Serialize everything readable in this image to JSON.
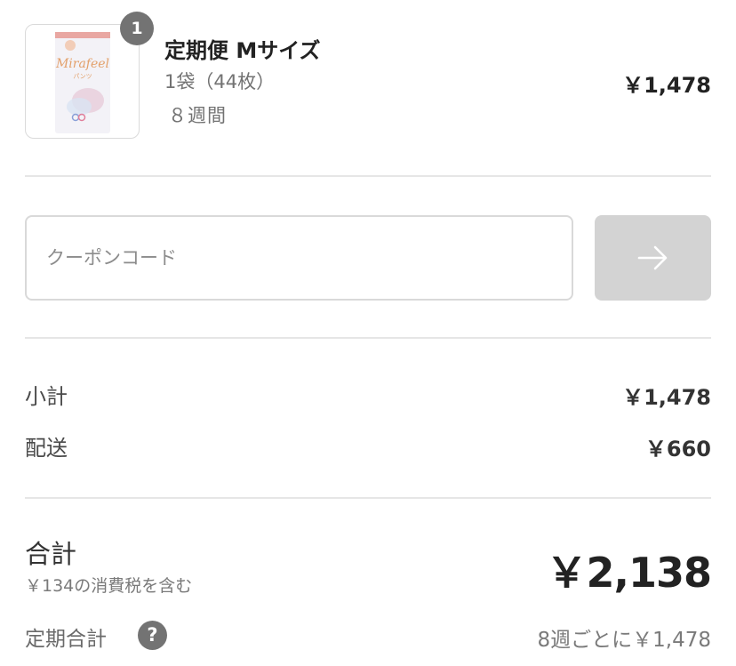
{
  "item": {
    "quantity": "1",
    "title": "定期便 Mサイズ",
    "variant": "1袋（44枚）",
    "interval": "８週間",
    "price": "￥1,478",
    "image": {
      "brand_text": "Mirafeel",
      "sub_text": "パンツ",
      "colors": {
        "pack": "#f3f2f7",
        "band": "#e9a7a2",
        "brand": "#e3a06a",
        "accent": "#e5c8d6"
      }
    }
  },
  "coupon": {
    "placeholder": "クーポンコード",
    "value": "",
    "submit_icon": "arrow-right-icon"
  },
  "summary": {
    "subtotal_label": "小計",
    "subtotal_value": "￥1,478",
    "shipping_label": "配送",
    "shipping_value": "￥660",
    "total_label": "合計",
    "tax_note": "￥134の消費税を含む",
    "total_value": "￥2,138",
    "subscription_label": "定期合計",
    "subscription_help_icon": "question-circle-icon",
    "subscription_value": "8週ごとに￥1,478"
  },
  "colors": {
    "divider": "#e6e6e6",
    "button_disabled": "#d3d3d3",
    "badge": "#737373",
    "text_primary": "#222222",
    "text_muted": "#7a7a7a"
  }
}
